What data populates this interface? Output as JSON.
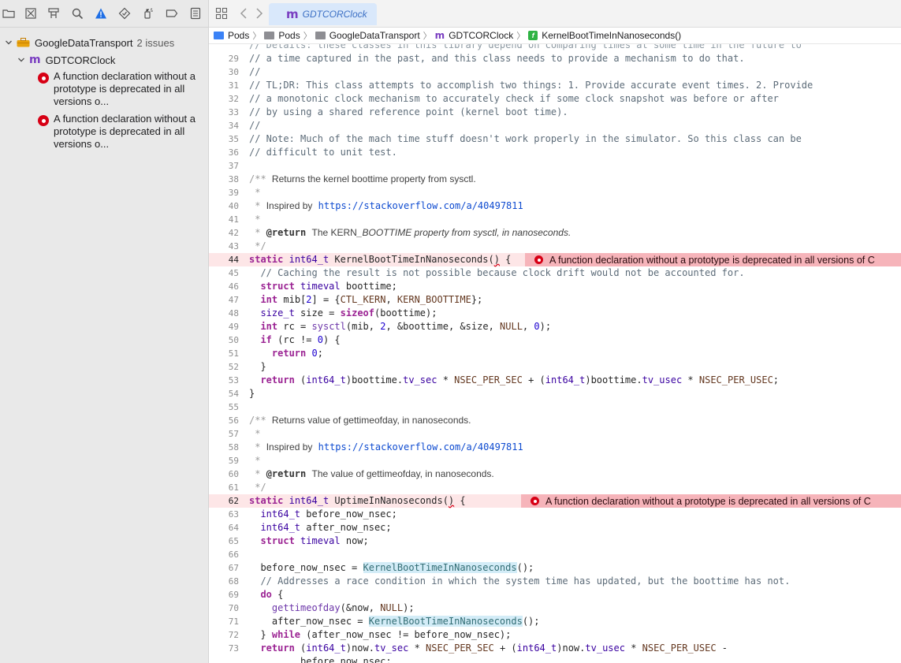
{
  "window": {
    "tab_title": "GDTCORClock",
    "tab_icon": "m"
  },
  "navigator": {
    "group": {
      "name": "GoogleDataTransport",
      "count": "2 issues"
    },
    "file": {
      "name": "GDTCORClock",
      "icon": "m"
    },
    "issues": [
      "A function declaration without a prototype is deprecated in all versions o...",
      "A function declaration without a prototype is deprecated in all versions o..."
    ]
  },
  "jumpbar": [
    "Pods",
    "Pods",
    "GoogleDataTransport",
    "GDTCORClock",
    "KernelBootTimeInNanoseconds()"
  ],
  "error_message": "A function declaration without a prototype is deprecated in all versions of C",
  "colors": {
    "error_red": "#d70015",
    "error_line": "#fde6e7",
    "error_annotation": "#f6b4ba",
    "tab_active": "#d9e8fb"
  },
  "code": {
    "line_numbers": [
      "29",
      "30",
      "31",
      "32",
      "33",
      "34",
      "35",
      "36",
      "37",
      "38",
      "39",
      "40",
      "41",
      "42",
      "43",
      "44",
      "45",
      "46",
      "47",
      "48",
      "49",
      "50",
      "51",
      "52",
      "53",
      "54",
      "55",
      "56",
      "57",
      "58",
      "59",
      "60",
      "61",
      "62",
      "63",
      "64",
      "65",
      "66",
      "67",
      "68",
      "69",
      "70",
      "71",
      "72",
      "73"
    ],
    "comments": {
      "l29": "// a time captured in the past, and this class needs to provide a mechanism to do that.",
      "l30": "//",
      "l31": "// TL;DR: This class attempts to accomplish two things: 1. Provide accurate event times. 2. Provide",
      "l32": "// a monotonic clock mechanism to accurately check if some clock snapshot was before or after",
      "l33": "// by using a shared reference point (kernel boot time).",
      "l34": "//",
      "l35": "// Note: Much of the mach time stuff doesn't work properly in the simulator. So this class can be",
      "l36": "// difficult to unit test.",
      "l45": "// Caching the result is not possible because clock drift would not be accounted for.",
      "l68": "// Addresses a race condition in which the system time has updated, but the boottime has not."
    },
    "docs": {
      "d38": "Returns the kernel boottime property from sysctl.",
      "d40": "Inspired by",
      "d40_link": "https://stackoverflow.com/a/40497811",
      "d42_tag": "@return",
      "d42a": "The KERN",
      "d42b": "_BOOTTIME property from sysctl, in nanoseconds.",
      "d56": "Returns value of gettimeofday, in nanoseconds.",
      "d58": "Inspired by",
      "d58_link": "https://stackoverflow.com/a/40497811",
      "d60_tag": "@return",
      "d60": "The value of gettimeofday, in nanoseconds."
    },
    "tokens": {
      "static": "static",
      "int64_t": "int64_t",
      "struct": "struct",
      "timeval": "timeval",
      "int": "int",
      "size_t": "size_t",
      "sizeof": "sizeof",
      "if": "if",
      "return": "return",
      "do": "do",
      "while": "while",
      "NULL": "NULL",
      "KernelBootTimeInNanoseconds": "KernelBootTimeInNanoseconds",
      "UptimeInNanoseconds": "UptimeInNanoseconds",
      "CTL_KERN": "CTL_KERN",
      "KERN_BOOTTIME": "KERN_BOOTTIME",
      "NSEC_PER_SEC": "NSEC_PER_SEC",
      "NSEC_PER_USEC": "NSEC_PER_USEC",
      "sysctl": "sysctl",
      "gettimeofday": "gettimeofday",
      "tv_sec": "tv_sec",
      "tv_usec": "tv_usec",
      "boottime": "boottime",
      "mib": "mib",
      "size": "size",
      "rc": "rc",
      "now": "now",
      "before_now_nsec": "before_now_nsec",
      "after_now_nsec": "after_now_nsec",
      "n0": "0",
      "n2": "2"
    }
  }
}
